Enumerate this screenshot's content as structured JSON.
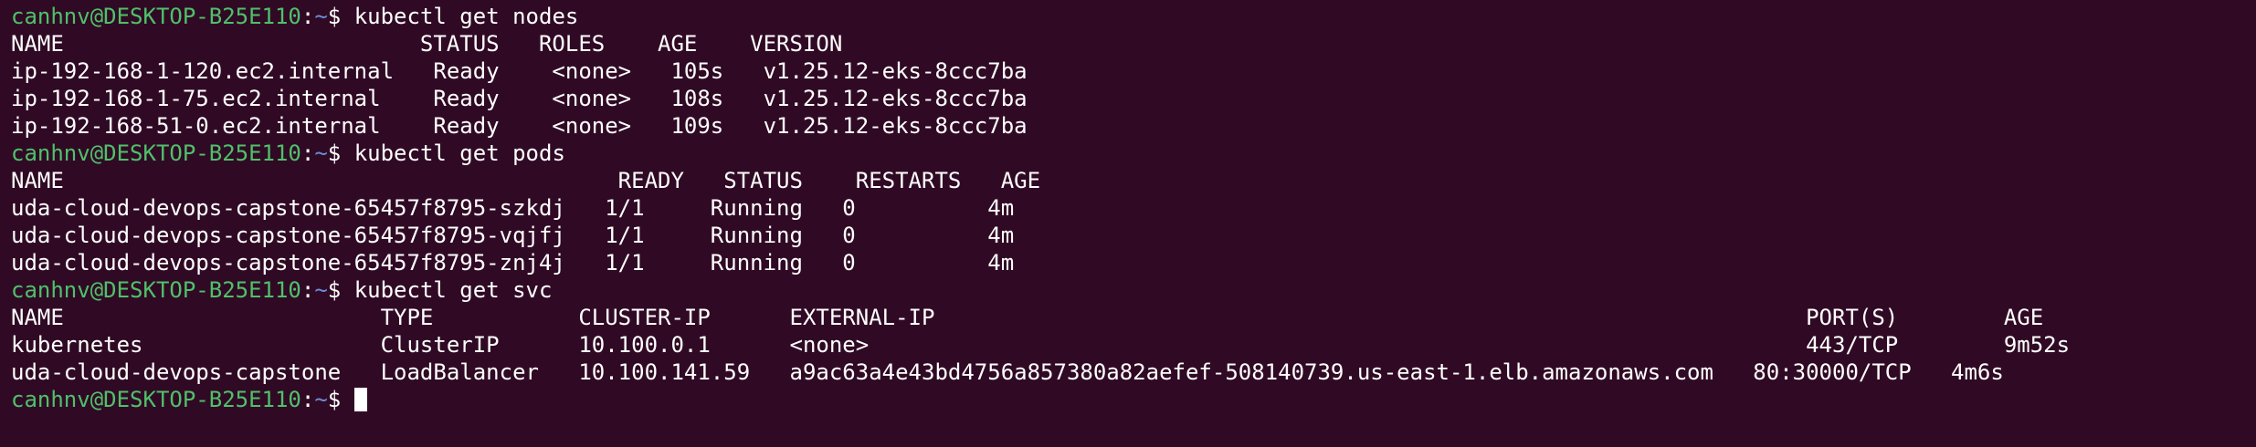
{
  "prompt": {
    "user_host": "canhnv@DESKTOP-B25E110",
    "separator": ":",
    "path": "~",
    "symbol": "$ "
  },
  "commands": {
    "nodes": "kubectl get nodes",
    "pods": "kubectl get pods",
    "svc": "kubectl get svc"
  },
  "output": {
    "nodes": [
      "NAME                           STATUS   ROLES    AGE    VERSION",
      "ip-192-168-1-120.ec2.internal   Ready    <none>   105s   v1.25.12-eks-8ccc7ba",
      "ip-192-168-1-75.ec2.internal    Ready    <none>   108s   v1.25.12-eks-8ccc7ba",
      "ip-192-168-51-0.ec2.internal    Ready    <none>   109s   v1.25.12-eks-8ccc7ba"
    ],
    "pods": [
      "NAME                                          READY   STATUS    RESTARTS   AGE",
      "uda-cloud-devops-capstone-65457f8795-szkdj   1/1     Running   0          4m",
      "uda-cloud-devops-capstone-65457f8795-vqjfj   1/1     Running   0          4m",
      "uda-cloud-devops-capstone-65457f8795-znj4j   1/1     Running   0          4m"
    ],
    "svc": [
      "NAME                        TYPE           CLUSTER-IP      EXTERNAL-IP                                                                  PORT(S)        AGE",
      "kubernetes                  ClusterIP      10.100.0.1      <none>                                                                       443/TCP        9m52s",
      "uda-cloud-devops-capstone   LoadBalancer   10.100.141.59   a9ac63a4e43bd4756a857380a82aefef-508140739.us-east-1.elb.amazonaws.com   80:30000/TCP   4m6s"
    ]
  }
}
